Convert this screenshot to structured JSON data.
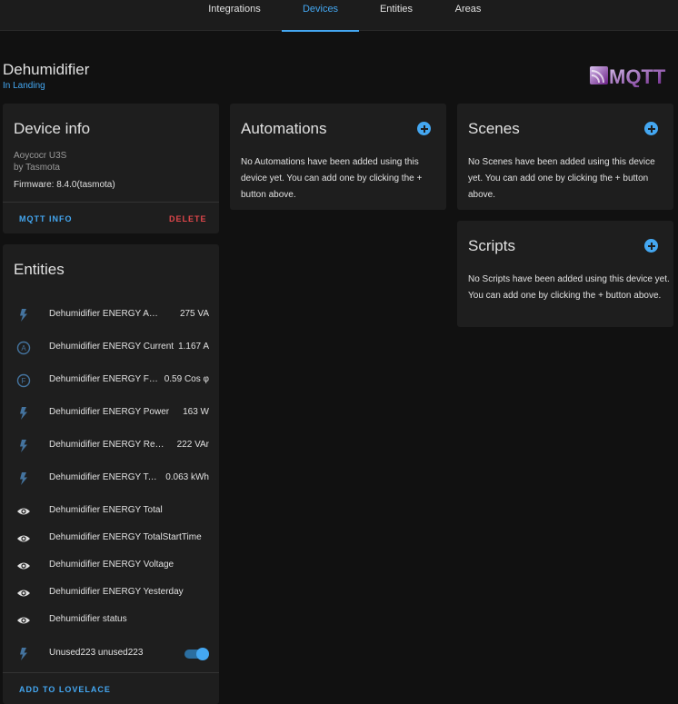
{
  "tabs": [
    "Integrations",
    "Devices",
    "Entities",
    "Areas"
  ],
  "device": {
    "name": "Dehumidifier",
    "area": "In Landing",
    "brand": "MQTT"
  },
  "device_info": {
    "title": "Device info",
    "model": "Aoycocr U3S",
    "manufacturer": "by Tasmota",
    "firmware": "Firmware: 8.4.0(tasmota)",
    "mqtt_info": "MQTT INFO",
    "delete": "DELETE"
  },
  "automations": {
    "title": "Automations",
    "text": "No Automations have been added using this device yet. You can add one by clicking the + button above."
  },
  "scenes": {
    "title": "Scenes",
    "text": "No Scenes have been added using this device yet. You can add one by clicking the + button above."
  },
  "scripts": {
    "title": "Scripts",
    "text": "No Scripts have been added using this device yet. You can add one by clicking the + button above."
  },
  "entities": {
    "title": "Entities",
    "add_to_lovelace": "ADD TO LOVELACE",
    "items": [
      {
        "icon": "flash-icon",
        "name": "Dehumidifier ENERGY Apparent Power",
        "value": "275 VA"
      },
      {
        "icon": "current-a-icon",
        "name": "Dehumidifier ENERGY Current",
        "value": "1.167 A"
      },
      {
        "icon": "power-factor-icon",
        "name": "Dehumidifier ENERGY Factor",
        "value": "0.59 Cos φ"
      },
      {
        "icon": "flash-icon",
        "name": "Dehumidifier ENERGY Power",
        "value": "163 W"
      },
      {
        "icon": "flash-icon",
        "name": "Dehumidifier ENERGY Reactive Power",
        "value": "222 VAr"
      },
      {
        "icon": "flash-icon",
        "name": "Dehumidifier ENERGY Today",
        "value": "0.063 kWh"
      },
      {
        "icon": "eye-icon",
        "name": "Dehumidifier ENERGY Total",
        "value": ""
      },
      {
        "icon": "eye-icon",
        "name": "Dehumidifier ENERGY TotalStartTime",
        "value": ""
      },
      {
        "icon": "eye-icon",
        "name": "Dehumidifier ENERGY Voltage",
        "value": ""
      },
      {
        "icon": "eye-icon",
        "name": "Dehumidifier ENERGY Yesterday",
        "value": ""
      },
      {
        "icon": "eye-icon",
        "name": "Dehumidifier status",
        "value": ""
      },
      {
        "icon": "flash-icon",
        "name": "Unused223 unused223",
        "value": "",
        "toggle_on": true
      }
    ]
  },
  "colors": {
    "accent": "#44a7f1",
    "danger": "#e0474b",
    "card": "#1e1e1e",
    "background": "#111111"
  }
}
